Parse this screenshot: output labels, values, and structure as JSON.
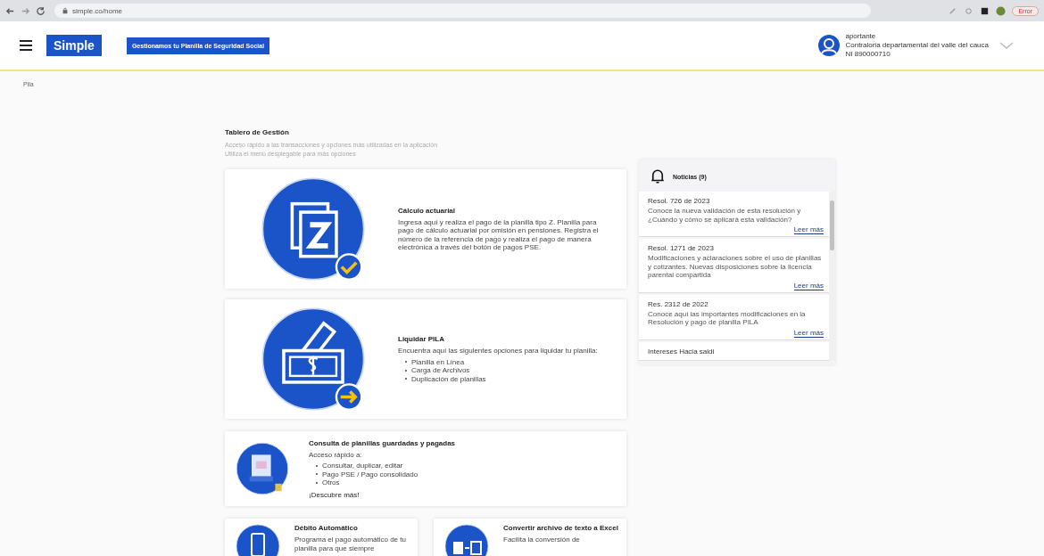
{
  "browser": {
    "address": "simple.co/home",
    "profile_badge": "Error"
  },
  "header": {
    "logo": "Simple",
    "tagline": "Gestionamos tu Planilla de Seguridad Social",
    "user": {
      "role": "aportante",
      "company": "Contraloria departamental del valle del cauca",
      "id": "NI 890000710"
    }
  },
  "breadcrumb": "Pila",
  "dashboard": {
    "title": "Tablero de Gestión",
    "subtitle": [
      "Acceso rápido a las transacciones y opciones más utilizadas en la aplicación",
      "Utiliza el menú desplegable para más opciones"
    ]
  },
  "cards": [
    {
      "kind": "large",
      "title": "Cálculo actuarial",
      "text": "Ingresa aquí y realiza el pago de la planilla tipo Z. Planilla para pago de cálculo actuarial por omisión en pensiones. Registra el número de la referencia de pago y realiza el pago de manera electrónica a través del botón de pagos PSE."
    },
    {
      "kind": "large",
      "title": "Liquidar PILA",
      "text": "Encuentra aquí las siguientes opciones para liquidar tu planilla:",
      "items": [
        "Planilla en Línea",
        "Carga de Archivos",
        "Duplicación de planillas"
      ]
    },
    {
      "kind": "medium",
      "title": "Consulta de planillas guardadas y pagadas",
      "text": "Acceso rápido a:",
      "items": [
        "Consultar, duplicar, editar",
        "Pago PSE / Pago consolidado",
        "Otros"
      ],
      "footer": "¡Descubre más!"
    },
    {
      "kind": "small",
      "title": "Débito Automático",
      "text": "Programa el pago automático de tu planilla para que siempre"
    },
    {
      "kind": "small",
      "title": "Convertir archivo de texto a Excel",
      "text": "Facilita la conversión de"
    }
  ],
  "news": {
    "title": "Noticias (9)",
    "items": [
      {
        "title": "Resol. 726 de 2023",
        "text": "Conoce la nueva validación de esta resolución y ¿Cuándo y cómo se aplicará esta validación?",
        "link": "Leer más"
      },
      {
        "title": "Resol. 1271 de 2023",
        "text": "Modificaciones y aclaraciones sobre el uso de planillas y cotizantes. Nuevas disposiciones sobre la licencia parental compartida",
        "link": "Leer más"
      },
      {
        "title": "Res. 2312 de 2022",
        "text": "Conoce aquí las importantes modificaciones en la Resolución y pago de planilla PILA",
        "link": "Leer más"
      },
      {
        "title": "Intereses Hacia saldi"
      }
    ]
  }
}
